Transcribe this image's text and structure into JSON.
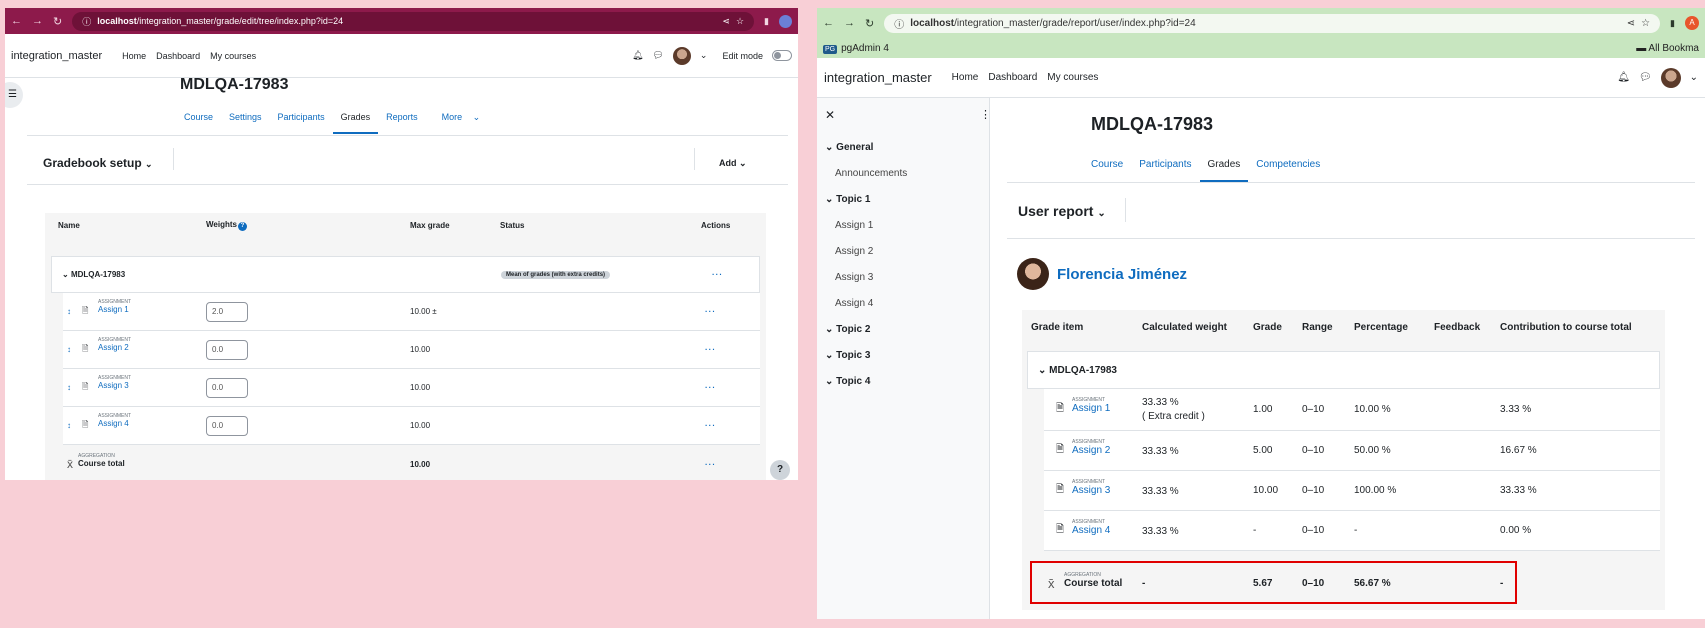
{
  "left": {
    "url_host": "localhost",
    "url_path": "/integration_master/grade/edit/tree/index.php?id=24",
    "brand": "integration_master",
    "nav": [
      "Home",
      "Dashboard",
      "My courses"
    ],
    "edit_mode": "Edit mode",
    "course_title": "MDLQA-17983",
    "tabs": [
      "Course",
      "Settings",
      "Participants",
      "Grades",
      "Reports",
      "More"
    ],
    "page_heading": "Gradebook setup",
    "add_label": "Add",
    "headers": {
      "name": "Name",
      "weights": "Weights",
      "max": "Max grade",
      "status": "Status",
      "actions": "Actions"
    },
    "category": {
      "name": "MDLQA-17983",
      "status": "Mean of grades (with extra credits)"
    },
    "items": [
      {
        "type": "ASSIGNMENT",
        "name": "Assign 1",
        "weight": "2.0",
        "max": "10.00",
        "extra": "±"
      },
      {
        "type": "ASSIGNMENT",
        "name": "Assign 2",
        "weight": "0.0",
        "max": "10.00",
        "extra": ""
      },
      {
        "type": "ASSIGNMENT",
        "name": "Assign 3",
        "weight": "0.0",
        "max": "10.00",
        "extra": ""
      },
      {
        "type": "ASSIGNMENT",
        "name": "Assign 4",
        "weight": "0.0",
        "max": "10.00",
        "extra": ""
      }
    ],
    "total": {
      "type": "AGGREGATION",
      "name": "Course total",
      "max": "10.00"
    },
    "help": "?"
  },
  "right": {
    "url_host": "localhost",
    "url_path": "/integration_master/grade/report/user/index.php?id=24",
    "bookmark": "pgAdmin 4",
    "bookmark_icon": "PG",
    "all_bookmarks": "All Bookma",
    "brand": "integration_master",
    "nav": [
      "Home",
      "Dashboard",
      "My courses"
    ],
    "drawer": {
      "sections": [
        {
          "title": "General",
          "items": [
            "Announcements"
          ]
        },
        {
          "title": "Topic 1",
          "items": [
            "Assign 1",
            "Assign 2",
            "Assign 3",
            "Assign 4"
          ]
        },
        {
          "title": "Topic 2",
          "items": []
        },
        {
          "title": "Topic 3",
          "items": []
        },
        {
          "title": "Topic 4",
          "items": []
        }
      ]
    },
    "course_title": "MDLQA-17983",
    "tabs": [
      "Course",
      "Participants",
      "Grades",
      "Competencies"
    ],
    "page_heading": "User report",
    "user_name": "Florencia Jiménez",
    "headers": [
      "Grade item",
      "Calculated weight",
      "Grade",
      "Range",
      "Percentage",
      "Feedback",
      "Contribution to course total"
    ],
    "category": "MDLQA-17983",
    "rows": [
      {
        "type": "ASSIGNMENT",
        "name": "Assign 1",
        "weight": "33.33 %",
        "note": "( Extra credit )",
        "grade": "1.00",
        "range": "0–10",
        "pct": "10.00 %",
        "contrib": "3.33 %"
      },
      {
        "type": "ASSIGNMENT",
        "name": "Assign 2",
        "weight": "33.33 %",
        "note": "",
        "grade": "5.00",
        "range": "0–10",
        "pct": "50.00 %",
        "contrib": "16.67 %"
      },
      {
        "type": "ASSIGNMENT",
        "name": "Assign 3",
        "weight": "33.33 %",
        "note": "",
        "grade": "10.00",
        "range": "0–10",
        "pct": "100.00 %",
        "contrib": "33.33 %"
      },
      {
        "type": "ASSIGNMENT",
        "name": "Assign 4",
        "weight": "33.33 %",
        "note": "",
        "grade": "-",
        "range": "0–10",
        "pct": "-",
        "contrib": "0.00 %"
      }
    ],
    "total": {
      "type": "AGGREGATION",
      "name": "Course total",
      "weight": "-",
      "grade": "5.67",
      "range": "0–10",
      "pct": "56.67 %",
      "contrib": "-"
    }
  },
  "colors": {
    "left_chrome": "#8d1a4b",
    "right_chrome": "#c8e6c0",
    "link": "#0f6cbf",
    "highlight": "#e00000",
    "background": "#f8cfd6"
  }
}
